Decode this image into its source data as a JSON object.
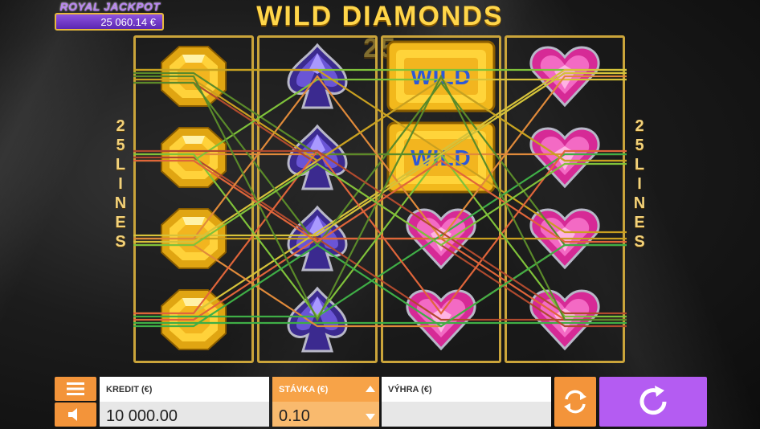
{
  "game": {
    "title": "WILD DIAMONDS 25",
    "lines_left": [
      "2",
      "5",
      "L",
      "I",
      "N",
      "E",
      "S"
    ],
    "lines_right": [
      "2",
      "5",
      "L",
      "I",
      "N",
      "E",
      "S"
    ]
  },
  "jackpot": {
    "title": "ROYAL JACKPOT",
    "value": "25 060.14 €"
  },
  "reels": [
    [
      "octagon-gem",
      "octagon-gem",
      "octagon-gem",
      "octagon-gem"
    ],
    [
      "spade-gem",
      "spade-gem",
      "spade-gem",
      "spade-gem"
    ],
    [
      "wild",
      "wild",
      "heart-gem",
      "heart-gem"
    ],
    [
      "heart-gem",
      "heart-gem",
      "heart-gem",
      "heart-gem"
    ]
  ],
  "wild_label": "WILD",
  "bottom": {
    "kredit_label": "KREDIT (€)",
    "kredit_value": "10 000.00",
    "stavka_label": "STÁVKA (€)",
    "stavka_value": "0.10",
    "vyhra_label": "VÝHRA (€)",
    "vyhra_value": ""
  },
  "colors": {
    "accent_orange": "#f3943a",
    "spin_purple": "#b45cf2",
    "reel_frame_gold": "#caa43a"
  }
}
